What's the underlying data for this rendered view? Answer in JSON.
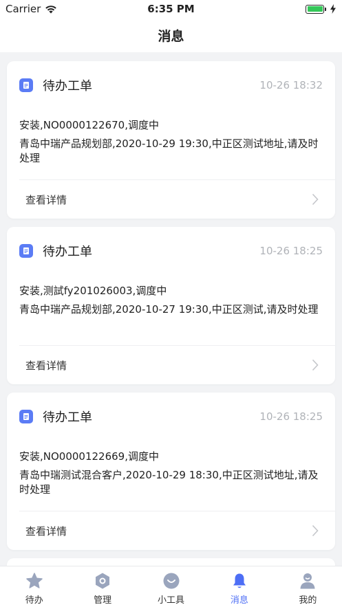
{
  "status_bar": {
    "carrier": "Carrier",
    "time": "6:35 PM"
  },
  "nav": {
    "title": "消息"
  },
  "messages": [
    {
      "title": "待办工单",
      "time": "10-26 18:32",
      "line1": "安装,NO0000122670,调度中",
      "line2": "青岛中瑞产品规划部,2020-10-29 19:30,中正区测试地址,请及时处理",
      "detail_label": "查看详情"
    },
    {
      "title": "待办工单",
      "time": "10-26 18:25",
      "line1": "安装,测試fy201026003,调度中",
      "line2": "青岛中瑞产品规划部,2020-10-27 19:30,中正区测试,请及时处理",
      "detail_label": "查看详情"
    },
    {
      "title": "待办工单",
      "time": "10-26 18:25",
      "line1": "安装,NO0000122669,调度中",
      "line2": "青岛中瑞测试混合客户,2020-10-29 18:30,中正区测试地址,请及时处理",
      "detail_label": "查看详情"
    }
  ],
  "tabs": [
    {
      "label": "待办",
      "icon": "star-icon"
    },
    {
      "label": "管理",
      "icon": "hexagon-icon"
    },
    {
      "label": "小工具",
      "icon": "smile-icon"
    },
    {
      "label": "消息",
      "icon": "bell-icon"
    },
    {
      "label": "我的",
      "icon": "user-icon"
    }
  ],
  "colors": {
    "accent": "#4d6ef5",
    "doc_icon": "#5b7cf5",
    "battery": "#34c759",
    "tab_inactive": "#9aa5bd"
  }
}
